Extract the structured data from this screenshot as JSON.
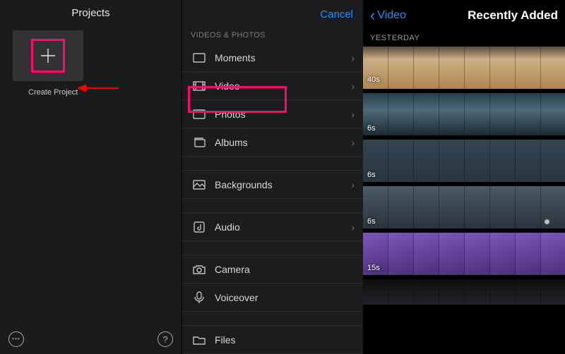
{
  "left": {
    "title": "Projects",
    "create_label": "Create Project"
  },
  "mid": {
    "cancel": "Cancel",
    "section": "VIDEOS & PHOTOS",
    "rows": {
      "moments": "Moments",
      "video": "Video",
      "photos": "Photos",
      "albums": "Albums",
      "backgrounds": "Backgrounds",
      "audio": "Audio",
      "camera": "Camera",
      "voiceover": "Voiceover",
      "files": "Files"
    }
  },
  "right": {
    "back": "Video",
    "title": "Recently Added",
    "section": "YESTERDAY",
    "clips": {
      "d1": "40s",
      "d2": "6s",
      "d3": "6s",
      "d4": "6s",
      "d5": "15s"
    }
  }
}
